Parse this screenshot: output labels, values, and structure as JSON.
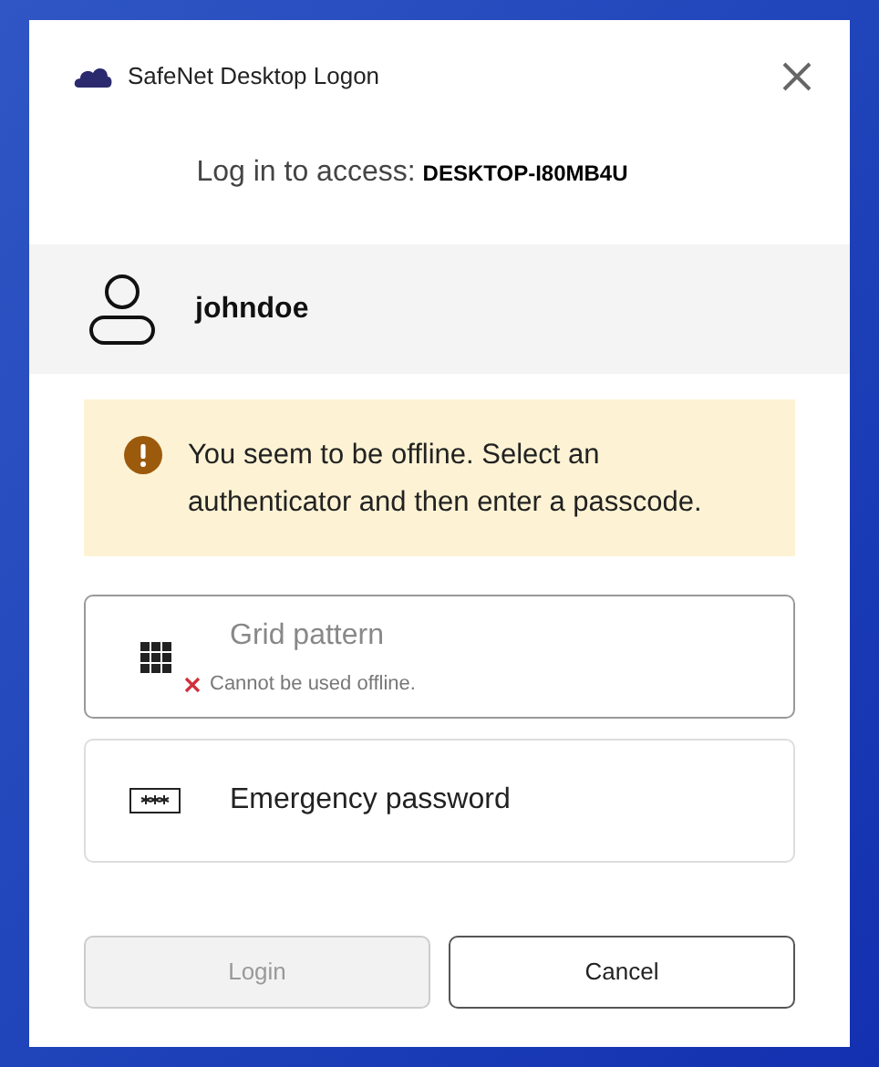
{
  "window": {
    "title": "SafeNet Desktop Logon"
  },
  "access": {
    "label": "Log in to access:",
    "machine": "DESKTOP-I80MB4U"
  },
  "user": {
    "name": "johndoe"
  },
  "notice": {
    "text": "You seem to be offline. Select an authenticator and then enter a passcode."
  },
  "authenticators": [
    {
      "kind": "grid",
      "label": "Grid pattern",
      "disabled": true,
      "error": "Cannot be used offline."
    },
    {
      "kind": "password",
      "label": "Emergency password",
      "disabled": false
    }
  ],
  "buttons": [
    {
      "label": "Login",
      "disabled": true
    },
    {
      "label": "Cancel",
      "disabled": false
    }
  ]
}
